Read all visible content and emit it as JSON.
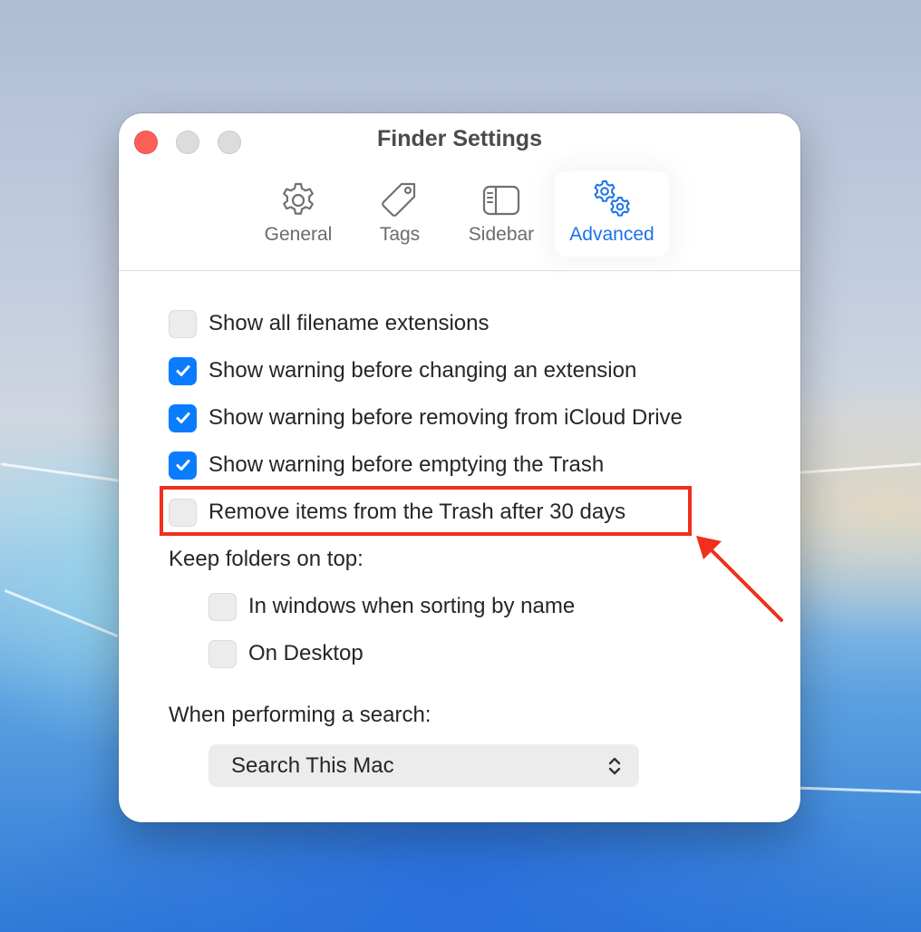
{
  "window": {
    "title": "Finder Settings"
  },
  "tabs": [
    {
      "label": "General",
      "icon": "gear-icon",
      "active": false
    },
    {
      "label": "Tags",
      "icon": "tag-icon",
      "active": false
    },
    {
      "label": "Sidebar",
      "icon": "sidebar-icon",
      "active": false
    },
    {
      "label": "Advanced",
      "icon": "gears-icon",
      "active": true
    }
  ],
  "options": [
    {
      "label": "Show all filename extensions",
      "checked": false
    },
    {
      "label": "Show warning before changing an extension",
      "checked": true
    },
    {
      "label": "Show warning before removing from iCloud Drive",
      "checked": true
    },
    {
      "label": "Show warning before emptying the Trash",
      "checked": true
    },
    {
      "label": "Remove items from the Trash after 30 days",
      "checked": false,
      "highlighted": true
    }
  ],
  "keep_folders": {
    "label": "Keep folders on top:",
    "options": [
      {
        "label": "In windows when sorting by name",
        "checked": false
      },
      {
        "label": "On Desktop",
        "checked": false
      }
    ]
  },
  "search": {
    "label": "When performing a search:",
    "selected": "Search This Mac"
  },
  "colors": {
    "accent": "#0a7cff",
    "annotation": "#f0301c",
    "close_button": "#fe5f57"
  }
}
